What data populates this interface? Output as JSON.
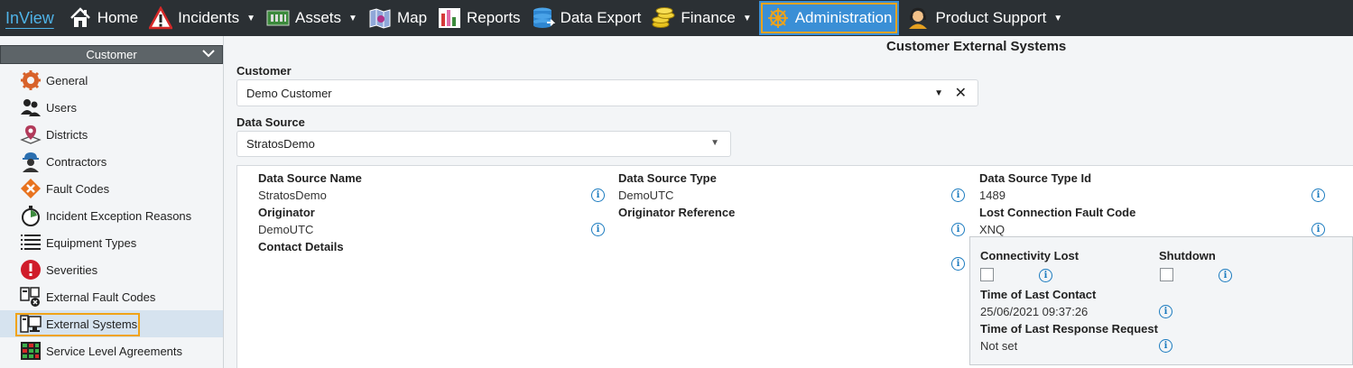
{
  "nav": {
    "brand": "InView",
    "items": [
      {
        "label": "Home",
        "icon": "house-icon",
        "caret": false
      },
      {
        "label": "Incidents",
        "icon": "warning-triangle-icon",
        "caret": true
      },
      {
        "label": "Assets",
        "icon": "circuit-board-icon",
        "caret": true
      },
      {
        "label": "Map",
        "icon": "map-icon",
        "caret": false
      },
      {
        "label": "Reports",
        "icon": "bar-chart-icon",
        "caret": false
      },
      {
        "label": "Data Export",
        "icon": "database-icon",
        "caret": false
      },
      {
        "label": "Finance",
        "icon": "coins-icon",
        "caret": true
      },
      {
        "label": "Administration",
        "icon": "ship-wheel-icon",
        "caret": false,
        "active": true
      },
      {
        "label": "Product Support",
        "icon": "support-agent-icon",
        "caret": true
      }
    ],
    "caret_glyph": "▼"
  },
  "sidebar": {
    "header": "Customer",
    "chevron": "❯",
    "items": [
      {
        "label": "General",
        "icon": "gear-icon"
      },
      {
        "label": "Users",
        "icon": "users-icon"
      },
      {
        "label": "Districts",
        "icon": "map-pin-icon"
      },
      {
        "label": "Contractors",
        "icon": "worker-icon"
      },
      {
        "label": "Fault Codes",
        "icon": "fault-diamond-icon"
      },
      {
        "label": "Incident Exception Reasons",
        "icon": "stopwatch-icon"
      },
      {
        "label": "Equipment Types",
        "icon": "list-icon"
      },
      {
        "label": "Severities",
        "icon": "alert-circle-icon"
      },
      {
        "label": "External Fault Codes",
        "icon": "external-fault-icon"
      },
      {
        "label": "External Systems",
        "icon": "computer-icon",
        "selected": true
      },
      {
        "label": "Service Level Agreements",
        "icon": "grid-icon"
      }
    ]
  },
  "main": {
    "title": "Customer External Systems",
    "customer_label": "Customer",
    "customer_value": "Demo Customer",
    "data_source_label": "Data Source",
    "data_source_value": "StratosDemo",
    "arrow": "▼",
    "clear": "✕"
  },
  "details": {
    "ds_name_label": "Data Source Name",
    "ds_name_value": "StratosDemo",
    "ds_type_label": "Data Source Type",
    "ds_type_value": "DemoUTC",
    "ds_type_id_label": "Data Source Type Id",
    "ds_type_id_value": "1489",
    "originator_label": "Originator",
    "originator_value": "DemoUTC",
    "originator_ref_label": "Originator Reference",
    "lost_conn_label": "Lost Connection Fault Code",
    "lost_conn_value": "XNQ",
    "contact_label": "Contact Details",
    "connectivity_lost_label": "Connectivity Lost",
    "shutdown_label": "Shutdown",
    "last_contact_label": "Time of Last Contact",
    "last_contact_value": "25/06/2021 09:37:26",
    "last_response_label": "Time of Last Response Request",
    "last_response_value": "Not set",
    "info_glyph": "i"
  },
  "colors": {
    "nav_bg": "#2b3034",
    "active_bg": "#3a8fd6",
    "highlight": "#f0a318",
    "info_blue": "#1b7bbf"
  }
}
